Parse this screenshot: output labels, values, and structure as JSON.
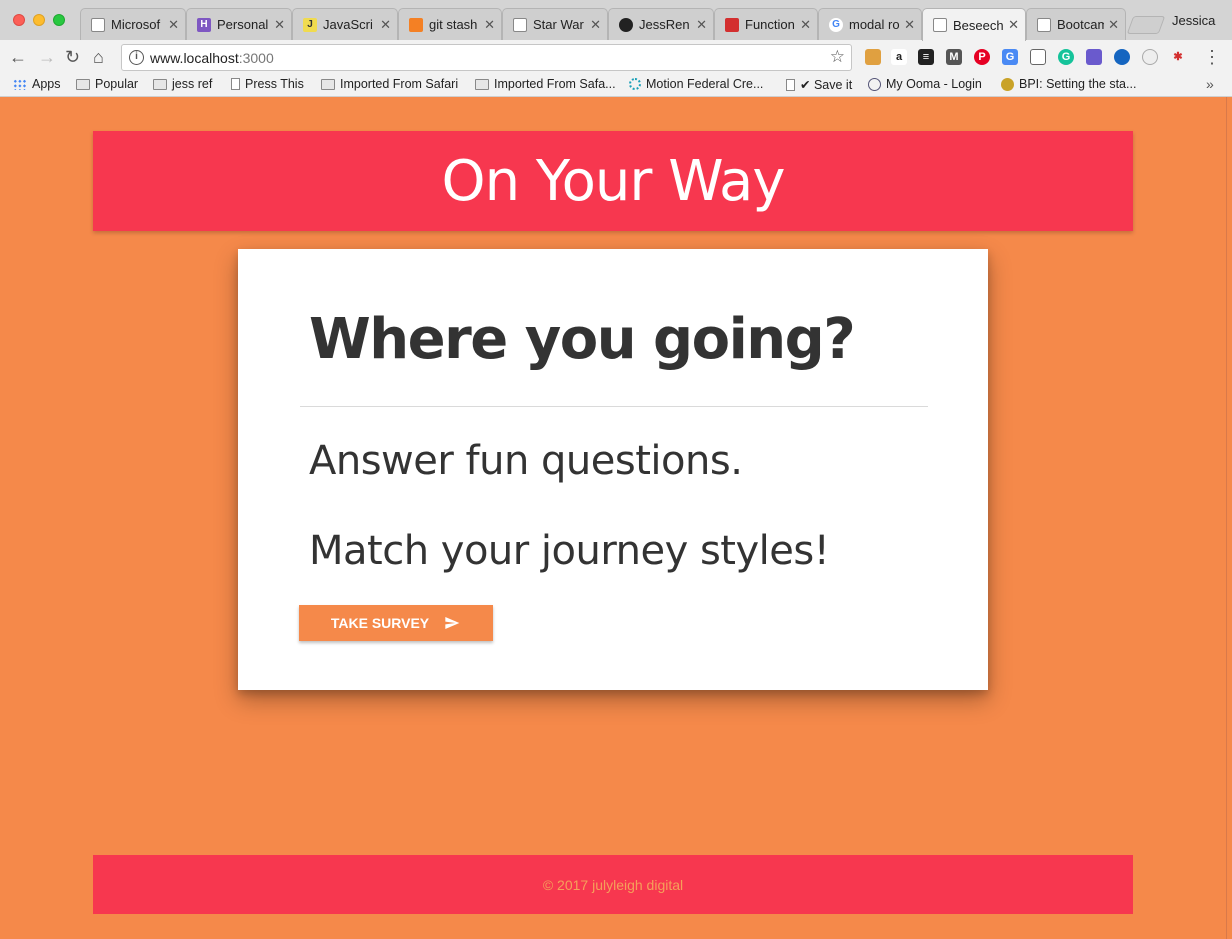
{
  "browser": {
    "profile_name": "Jessica",
    "tabs": [
      {
        "label": "Microsof",
        "icon": "page-icon"
      },
      {
        "label": "Personal",
        "icon": "heroku-icon"
      },
      {
        "label": "JavaScri",
        "icon": "js-icon"
      },
      {
        "label": "git stash",
        "icon": "stackoverflow-icon"
      },
      {
        "label": "Star War",
        "icon": "page-icon"
      },
      {
        "label": "JessRen",
        "icon": "github-icon"
      },
      {
        "label": "Function",
        "icon": "site-icon"
      },
      {
        "label": "modal ro",
        "icon": "google-icon"
      },
      {
        "label": "Beseech",
        "icon": "page-icon",
        "active": true
      },
      {
        "label": "Bootcam",
        "icon": "page-icon"
      }
    ],
    "url_host": "www.localhost",
    "url_port": ":3000",
    "bookmarks": [
      {
        "label": "Apps",
        "icon": "apps-icon"
      },
      {
        "label": "Popular",
        "icon": "folder-icon"
      },
      {
        "label": "jess ref",
        "icon": "folder-icon"
      },
      {
        "label": "Press This",
        "icon": "page-icon"
      },
      {
        "label": "Imported From Safari",
        "icon": "folder-icon"
      },
      {
        "label": "Imported From Safa...",
        "icon": "folder-icon"
      },
      {
        "label": "Motion Federal Cre...",
        "icon": "site-icon"
      },
      {
        "label": "✔ Save it",
        "icon": "page-icon"
      },
      {
        "label": "My Ooma - Login",
        "icon": "site-icon"
      },
      {
        "label": "BPI: Setting the sta...",
        "icon": "site-icon"
      }
    ],
    "bookmarks_overflow": "»"
  },
  "page": {
    "header_title": "On Your Way",
    "card": {
      "title": "Where you going?",
      "line1": "Answer fun questions.",
      "line2": "Match your journey styles!",
      "button_label": "TAKE SURVEY"
    },
    "footer_text": "© 2017 julyleigh digital"
  },
  "colors": {
    "page_background": "#f5894a",
    "header_background": "#f7374f",
    "card_background": "#ffffff",
    "button_background": "#f5894a"
  }
}
